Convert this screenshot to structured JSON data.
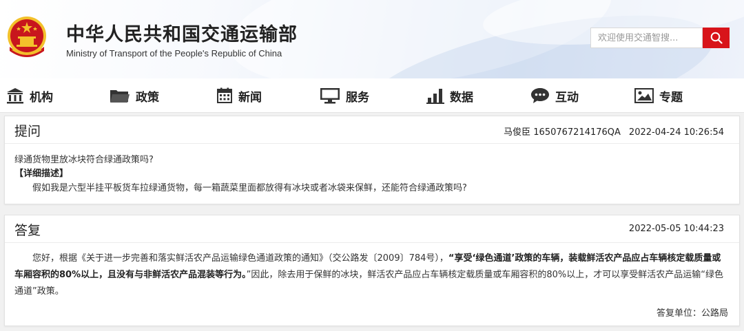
{
  "header": {
    "title_cn": "中华人民共和国交通运输部",
    "title_en": "Ministry of Transport of the People's Republic of China",
    "emblem_icon": "national-emblem-icon",
    "search": {
      "placeholder": "欢迎使用交通智搜...",
      "button_icon": "search-icon"
    }
  },
  "colors": {
    "accent": "#d8141a",
    "emblem_red": "#c8161d",
    "emblem_gold": "#f3c12b"
  },
  "nav": {
    "items": [
      {
        "label": "机构",
        "icon": "institution-icon"
      },
      {
        "label": "政策",
        "icon": "folder-icon"
      },
      {
        "label": "新闻",
        "icon": "calendar-icon"
      },
      {
        "label": "服务",
        "icon": "monitor-icon"
      },
      {
        "label": "数据",
        "icon": "bar-chart-icon"
      },
      {
        "label": "互动",
        "icon": "chat-bubble-icon"
      },
      {
        "label": "专题",
        "icon": "picture-icon"
      }
    ]
  },
  "question": {
    "heading": "提问",
    "asker": "马俊臣 1650767214176QA",
    "time": "2022-04-24 10:26:54",
    "title": "绿通货物里放冰块符合绿通政策吗?",
    "detail_label": "【详细描述】",
    "detail": "假如我是六型半挂平板货车拉绿通货物，每一箱蔬菜里面都放得有冰块或者冰袋来保鲜，还能符合绿通政策吗?"
  },
  "answer": {
    "heading": "答复",
    "time": "2022-05-05 10:44:23",
    "part1": "您好，根据《关于进一步完善和落实鲜活农产品运输绿色通道政策的通知》（交公路发〔2009〕784号），",
    "part2_bold": "“享受‘绿色通道’政策的车辆，装载鲜活农产品应占车辆核定载质量或车厢容积的80%以上，且没有与非鲜活农产品混装等行为。",
    "part3": "”因此，除去用于保鲜的冰块，鲜活农产品应占车辆核定载质量或车厢容积的80%以上，才可以享受鲜活农产品运输“绿色通道”政策。",
    "signature": "答复单位：公路局"
  }
}
